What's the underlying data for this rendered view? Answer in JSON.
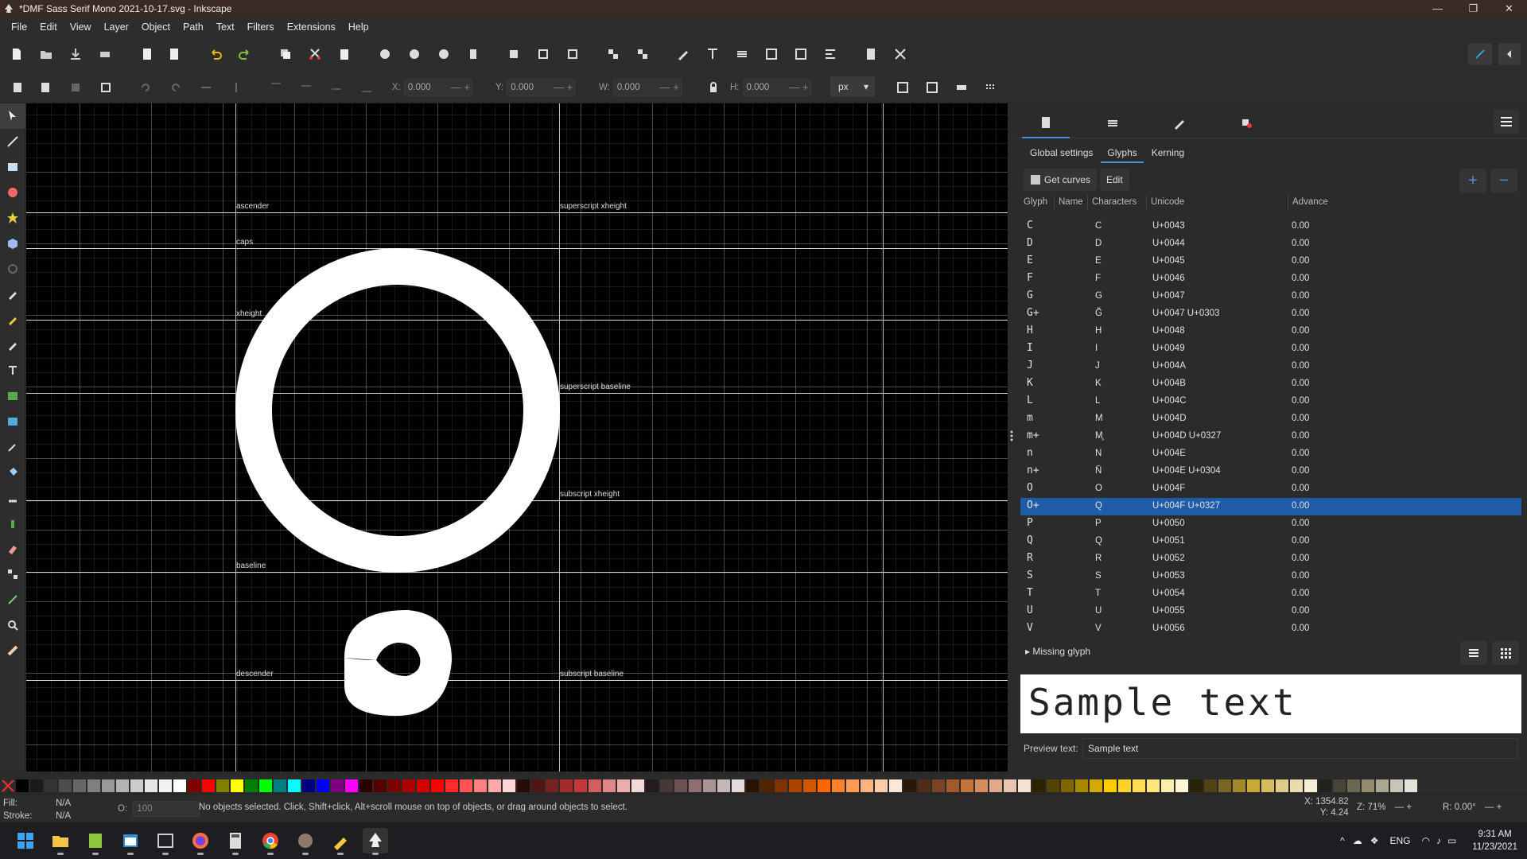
{
  "window": {
    "title": "*DMF Sass Serif Mono 2021-10-17.svg - Inkscape",
    "controls": [
      "—",
      "❐",
      "✕"
    ]
  },
  "menu": [
    "File",
    "Edit",
    "View",
    "Layer",
    "Object",
    "Path",
    "Text",
    "Filters",
    "Extensions",
    "Help"
  ],
  "tool_controls": {
    "x": {
      "label": "X:",
      "value": "0.000"
    },
    "y": {
      "label": "Y:",
      "value": "0.000"
    },
    "w": {
      "label": "W:",
      "value": "0.000"
    },
    "h": {
      "label": "H:",
      "value": "0.000"
    },
    "unit": "px"
  },
  "guides": {
    "ascender": "ascender",
    "caps": "caps",
    "xheight": "xheight",
    "baseline": "baseline",
    "descender": "descender",
    "superscript_xheight": "superscript xheight",
    "superscript_baseline": "superscript baseline",
    "subscript_xheight": "subscript xheight",
    "subscript_baseline": "subscript baseline"
  },
  "panel": {
    "subtabs": [
      "Global settings",
      "Glyphs",
      "Kerning"
    ],
    "active_subtab": "Glyphs",
    "get_curves": "Get curves",
    "edit": "Edit",
    "columns": [
      "Glyph",
      "Name",
      "Characters",
      "Unicode",
      "Advance"
    ],
    "rows": [
      {
        "glyph": "C",
        "chars": "C",
        "unicode": "U+0043",
        "advance": "0.00"
      },
      {
        "glyph": "D",
        "chars": "D",
        "unicode": "U+0044",
        "advance": "0.00"
      },
      {
        "glyph": "E",
        "chars": "E",
        "unicode": "U+0045",
        "advance": "0.00"
      },
      {
        "glyph": "F",
        "chars": "F",
        "unicode": "U+0046",
        "advance": "0.00"
      },
      {
        "glyph": "G",
        "chars": "G",
        "unicode": "U+0047",
        "advance": "0.00"
      },
      {
        "glyph": "G+",
        "chars": "G̃",
        "unicode": "U+0047 U+0303",
        "advance": "0.00"
      },
      {
        "glyph": "H",
        "chars": "H",
        "unicode": "U+0048",
        "advance": "0.00"
      },
      {
        "glyph": "I",
        "chars": "I",
        "unicode": "U+0049",
        "advance": "0.00"
      },
      {
        "glyph": "J",
        "chars": "J",
        "unicode": "U+004A",
        "advance": "0.00"
      },
      {
        "glyph": "K",
        "chars": "K",
        "unicode": "U+004B",
        "advance": "0.00"
      },
      {
        "glyph": "L",
        "chars": "L",
        "unicode": "U+004C",
        "advance": "0.00"
      },
      {
        "glyph": "m",
        "chars": "M",
        "unicode": "U+004D",
        "advance": "0.00"
      },
      {
        "glyph": "m+",
        "chars": "M̧",
        "unicode": "U+004D U+0327",
        "advance": "0.00"
      },
      {
        "glyph": "n",
        "chars": "N",
        "unicode": "U+004E",
        "advance": "0.00"
      },
      {
        "glyph": "n+",
        "chars": "N̄",
        "unicode": "U+004E U+0304",
        "advance": "0.00"
      },
      {
        "glyph": "O",
        "chars": "O",
        "unicode": "U+004F",
        "advance": "0.00"
      },
      {
        "glyph": "O+",
        "chars": "Q",
        "unicode": "U+004F U+0327",
        "advance": "0.00",
        "selected": true
      },
      {
        "glyph": "P",
        "chars": "P",
        "unicode": "U+0050",
        "advance": "0.00"
      },
      {
        "glyph": "Q",
        "chars": "Q",
        "unicode": "U+0051",
        "advance": "0.00"
      },
      {
        "glyph": "R",
        "chars": "R",
        "unicode": "U+0052",
        "advance": "0.00"
      },
      {
        "glyph": "S",
        "chars": "S",
        "unicode": "U+0053",
        "advance": "0.00"
      },
      {
        "glyph": "T",
        "chars": "T",
        "unicode": "U+0054",
        "advance": "0.00"
      },
      {
        "glyph": "U",
        "chars": "U",
        "unicode": "U+0055",
        "advance": "0.00"
      },
      {
        "glyph": "V",
        "chars": "V",
        "unicode": "U+0056",
        "advance": "0.00"
      }
    ],
    "missing_glyph": "Missing glyph",
    "preview_sample": "Sample text",
    "preview_label": "Preview text:",
    "preview_value": "Sample text"
  },
  "status": {
    "fill_label": "Fill:",
    "fill_value": "N/A",
    "stroke_label": "Stroke:",
    "stroke_value": "N/A",
    "opacity_label": "O:",
    "opacity_value": "100",
    "message": "No objects selected. Click, Shift+click, Alt+scroll mouse on top of objects, or drag around objects to select.",
    "x_label": "X:",
    "x": "1354.82",
    "y_label": "Y:",
    "y": "4.24",
    "zoom_label": "Z:",
    "zoom": "71%",
    "rotation_label": "R:",
    "rotation": "0.00°"
  },
  "taskbar": {
    "language": "ENG",
    "time": "9:31 AM",
    "date": "11/23/2021"
  },
  "colors": {
    "accent": "#1f5ca8",
    "canvas": "#000000",
    "glyph": "#ffffff"
  }
}
